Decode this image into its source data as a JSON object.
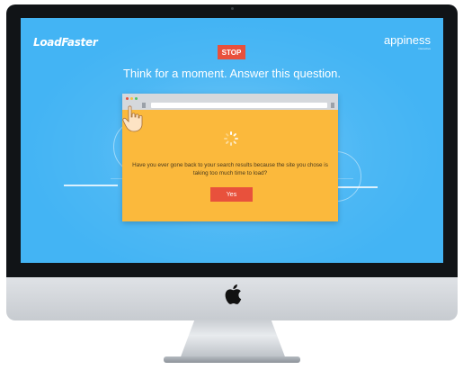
{
  "screen": {
    "logo_left": "LoadFaster",
    "logo_right": "appiness",
    "logo_right_sub": "interactive",
    "stop_label": "STOP",
    "headline": "Think for a moment. Answer this question.",
    "question": "Have you ever gone back to your search results because the site you chose is taking too much time to load?",
    "yes_label": "Yes"
  },
  "colors": {
    "screen_background": "#43b4f4",
    "dialog_background": "#fbb93c",
    "accent_red": "#e8513c",
    "browser_dot_red": "#e8513c",
    "browser_dot_yellow": "#f5c242",
    "browser_dot_green": "#4cc36b"
  },
  "icons": {
    "hand": "pointing-hand-icon",
    "spinner": "loading-spinner-icon",
    "apple": "apple-logo-icon"
  }
}
